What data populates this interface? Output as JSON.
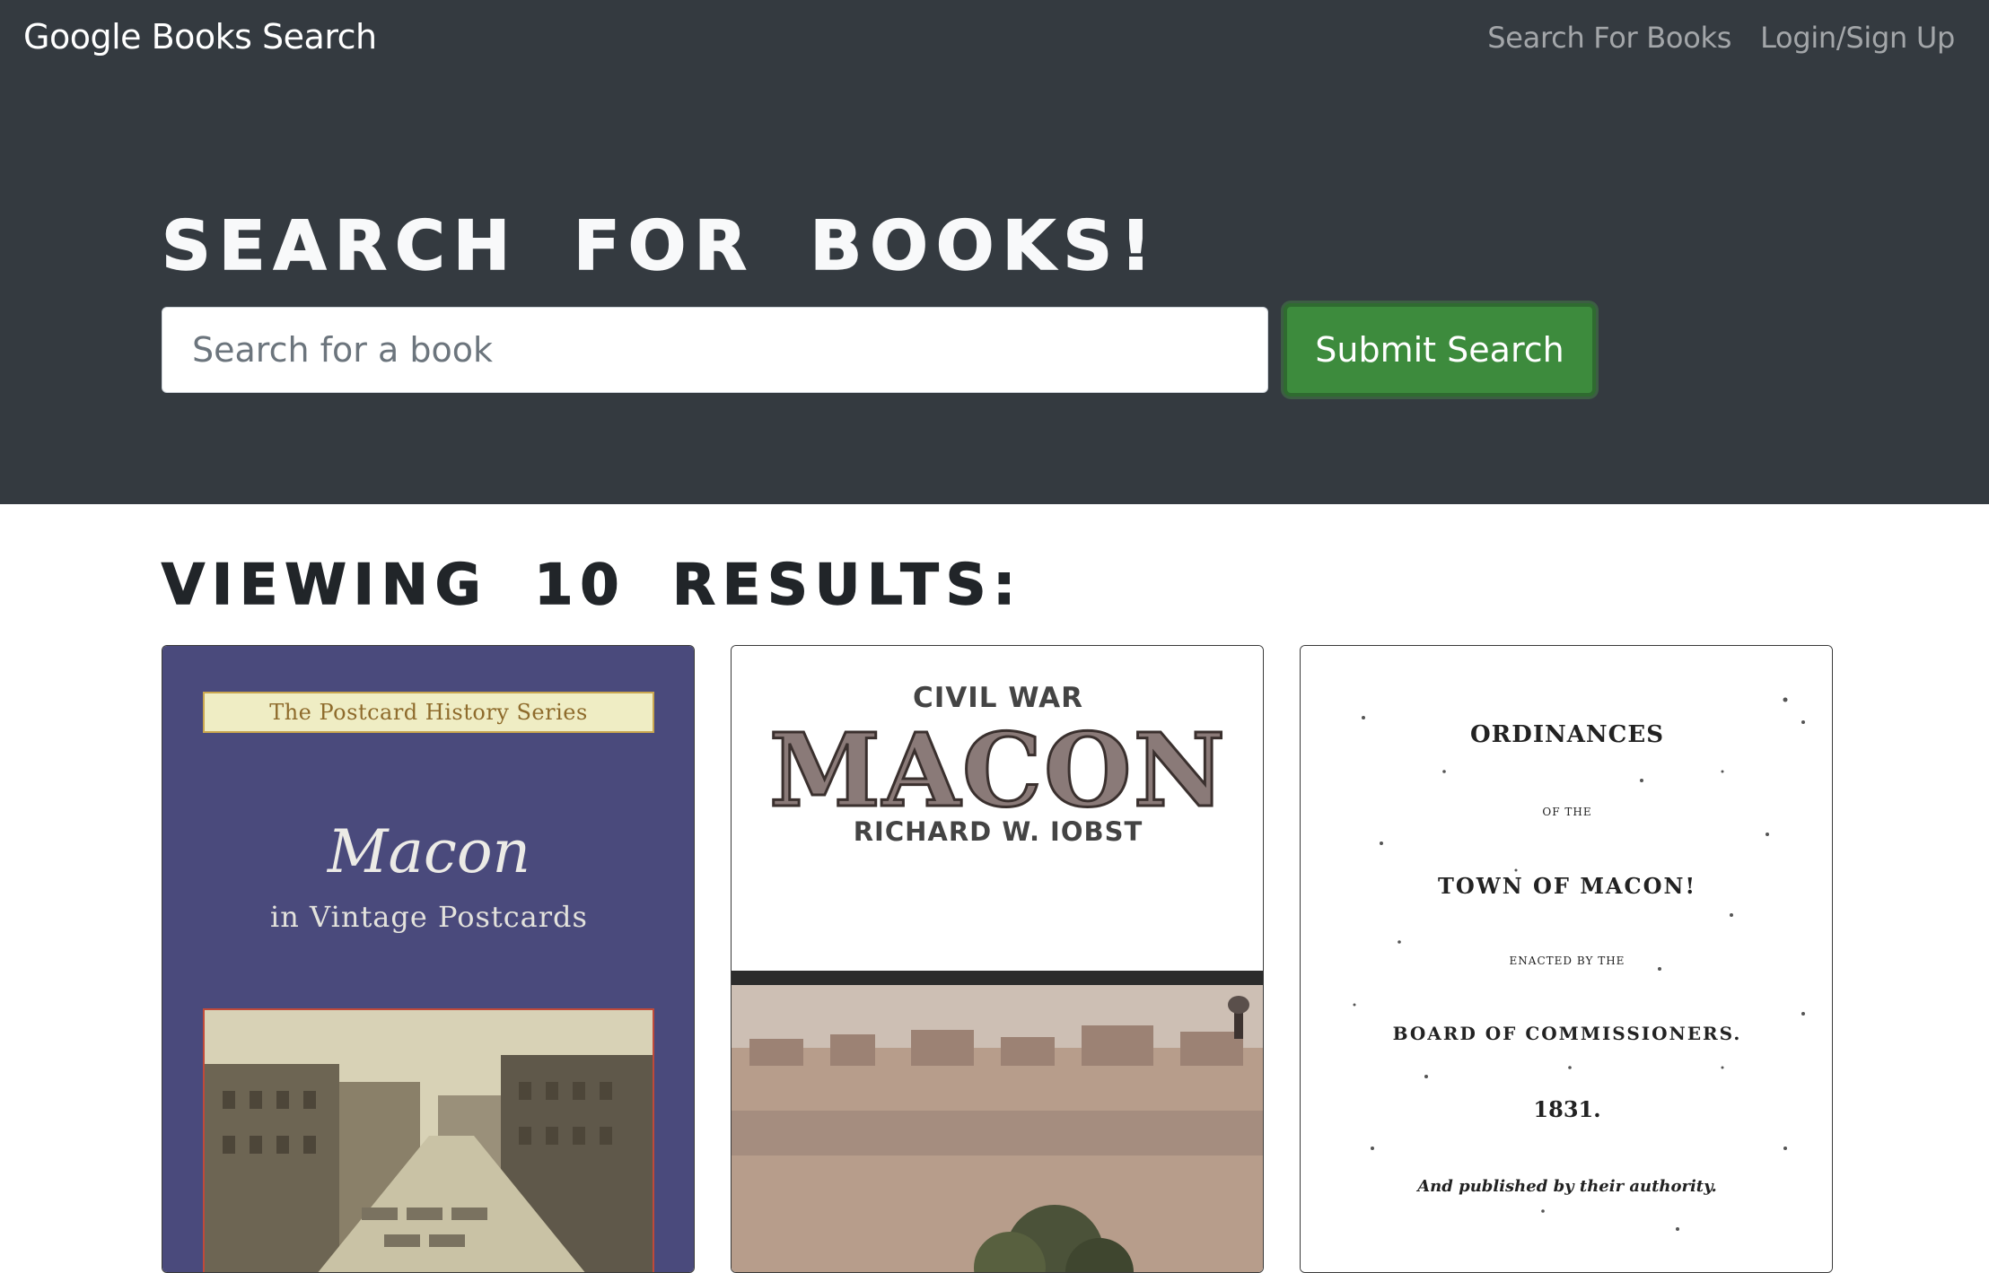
{
  "navbar": {
    "brand": "Google Books Search",
    "links": [
      {
        "label": "Search For Books"
      },
      {
        "label": "Login/Sign Up"
      }
    ]
  },
  "hero": {
    "title": "Search for Books!",
    "search_placeholder": "Search for a book",
    "search_value": "",
    "submit_label": "Submit Search"
  },
  "results": {
    "heading": "Viewing 10 results:",
    "books": [
      {
        "cover_series": "The Postcard History Series",
        "cover_title": "Macon",
        "cover_subtitle": "in Vintage Postcards"
      },
      {
        "cover_kicker": "CIVIL WAR",
        "cover_title": "MACON",
        "cover_author": "RICHARD W. IOBST"
      },
      {
        "cover_lines": [
          "ORDINANCES",
          "OF THE",
          "TOWN OF MACON!",
          "ENACTED BY THE",
          "BOARD OF COMMISSIONERS.",
          "1831.",
          "And published by their authority."
        ]
      }
    ]
  },
  "colors": {
    "navbar_bg": "#343a40",
    "submit_bg": "#3d8b3d",
    "cover1_bg": "#4a4a7c"
  }
}
